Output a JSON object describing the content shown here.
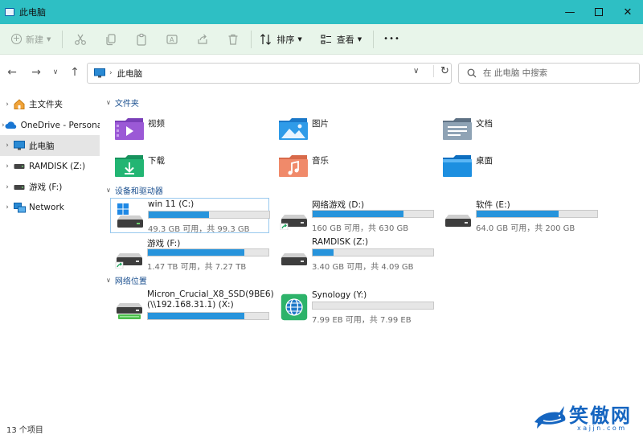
{
  "window": {
    "title": "此电脑"
  },
  "toolbar": {
    "new_label": "新建",
    "sort_label": "排序",
    "view_label": "查看",
    "more_label": "•••"
  },
  "address": {
    "location": "此电脑",
    "search_placeholder": "在 此电脑 中搜索"
  },
  "sidebar": {
    "items": [
      {
        "label": "主文件夹"
      },
      {
        "label": "OneDrive - Persona"
      },
      {
        "label": "此电脑"
      },
      {
        "label": "RAMDISK (Z:)"
      },
      {
        "label": "游戏 (F:)"
      },
      {
        "label": "Network"
      }
    ]
  },
  "sections": {
    "folders": "文件夹",
    "drives": "设备和驱动器",
    "network": "网络位置"
  },
  "folders": [
    {
      "label": "视频",
      "icon": "video-folder-icon"
    },
    {
      "label": "图片",
      "icon": "pictures-folder-icon"
    },
    {
      "label": "文档",
      "icon": "documents-folder-icon"
    },
    {
      "label": "下载",
      "icon": "downloads-folder-icon"
    },
    {
      "label": "音乐",
      "icon": "music-folder-icon"
    },
    {
      "label": "桌面",
      "icon": "desktop-folder-icon"
    }
  ],
  "drives": [
    {
      "name": "win 11 (C:)",
      "info": "49.3 GB 可用，共 99.3 GB",
      "used": 0.5
    },
    {
      "name": "网络游戏 (D:)",
      "info": "160 GB 可用，共 630 GB",
      "used": 0.75
    },
    {
      "name": "软件 (E:)",
      "info": "64.0 GB 可用，共 200 GB",
      "used": 0.68
    },
    {
      "name": "游戏 (F:)",
      "info": "1.47 TB 可用，共 7.27 TB",
      "used": 0.8
    },
    {
      "name": "RAMDISK (Z:)",
      "info": "3.40 GB 可用，共 4.09 GB",
      "used": 0.17
    }
  ],
  "network": [
    {
      "name_line1": "Micron_Crucial_X8_SSD(9BE6)",
      "name_line2": "(\\\\192.168.31.1) (X:)",
      "info": "",
      "used": 0.8
    },
    {
      "name": "Synology (Y:)",
      "info": "7.99 EB 可用，共 7.99 EB",
      "used": 0.0
    }
  ],
  "status": {
    "item_count": "13 个项目"
  },
  "watermark": {
    "brand": "笑傲网",
    "url": "x a j j n . c o m"
  },
  "colors": {
    "titlebar": "#2ebfc4",
    "toolbar": "#e8f5ea",
    "bar_fill": "#2794dc",
    "section_text": "#1a4f8f"
  }
}
